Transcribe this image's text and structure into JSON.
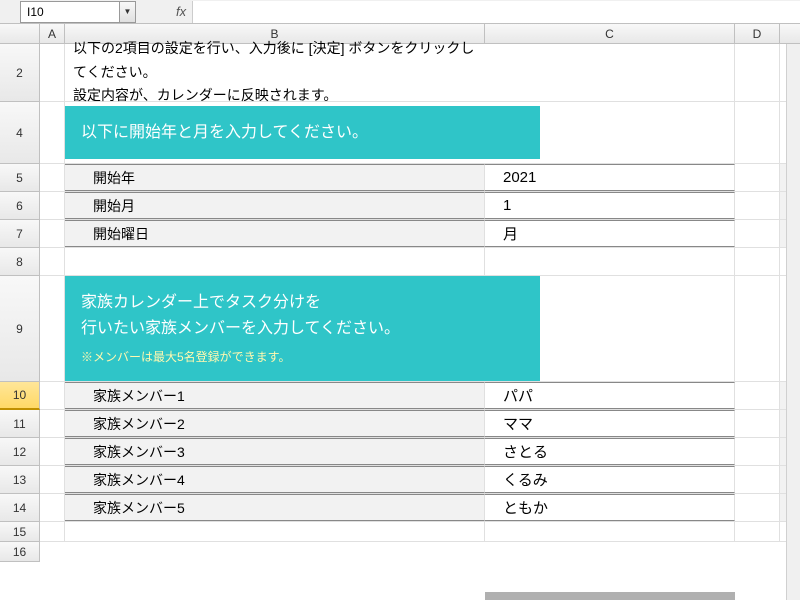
{
  "formula_bar": {
    "name_box": "I10",
    "fx_label": "fx"
  },
  "columns": [
    "A",
    "B",
    "C",
    "D"
  ],
  "rows": [
    "2",
    "4",
    "5",
    "6",
    "7",
    "8",
    "9",
    "10",
    "11",
    "12",
    "13",
    "14",
    "15",
    "16"
  ],
  "selected_row": "10",
  "instructions": {
    "line1": "以下の2項目の設定を行い、入力後に [決定] ボタンをクリックしてください。",
    "line2": "設定内容が、カレンダーに反映されます。"
  },
  "banner1": {
    "text": "以下に開始年と月を入力してください。"
  },
  "date_settings": {
    "rows": [
      {
        "label": "開始年",
        "value": "2021"
      },
      {
        "label": "開始月",
        "value": "1"
      },
      {
        "label": "開始曜日",
        "value": "月"
      }
    ]
  },
  "banner2": {
    "line1": "家族カレンダー上でタスク分けを",
    "line2": "行いたい家族メンバーを入力してください。",
    "note": "※メンバーは最大5名登録ができます。"
  },
  "family_members": {
    "rows": [
      {
        "label": "家族メンバー1",
        "value": "パパ"
      },
      {
        "label": "家族メンバー2",
        "value": "ママ"
      },
      {
        "label": "家族メンバー3",
        "value": "さとる"
      },
      {
        "label": "家族メンバー4",
        "value": "くるみ"
      },
      {
        "label": "家族メンバー5",
        "value": "ともか"
      }
    ]
  }
}
